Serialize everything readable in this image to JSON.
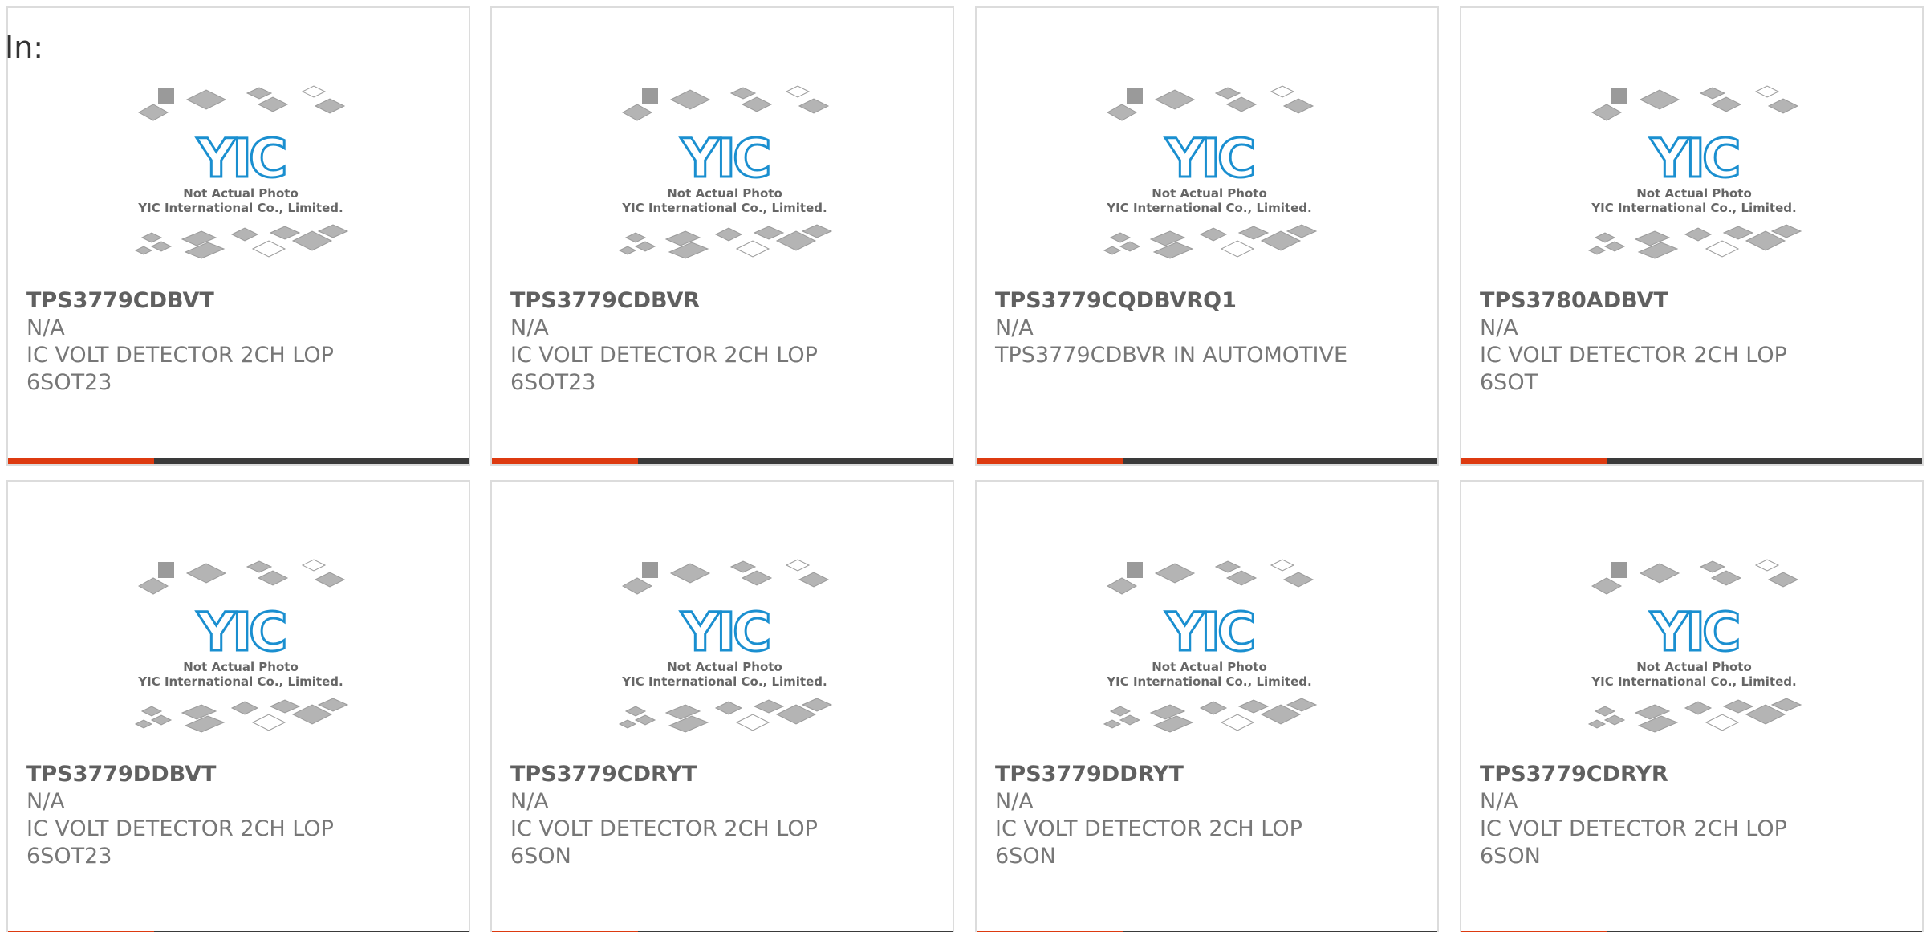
{
  "header": {
    "label": "In:"
  },
  "brand": {
    "accent": "#dd3a10",
    "bar": "#3a3a3a",
    "logo_blue": "#1a8fd0"
  },
  "placeholder": {
    "logo": "YIC",
    "line1": "Not Actual Photo",
    "line2": "YIC International Co., Limited."
  },
  "products": [
    {
      "part": "TPS3779CDBVT",
      "mfr": "N/A",
      "desc1": "IC VOLT DETECTOR 2CH LOP",
      "desc2": "6SOT23"
    },
    {
      "part": "TPS3779CDBVR",
      "mfr": "N/A",
      "desc1": "IC VOLT DETECTOR 2CH LOP",
      "desc2": "6SOT23"
    },
    {
      "part": "TPS3779CQDBVRQ1",
      "mfr": "N/A",
      "desc1": "TPS3779CDBVR IN AUTOMOTIVE",
      "desc2": ""
    },
    {
      "part": "TPS3780ADBVT",
      "mfr": "N/A",
      "desc1": "IC VOLT DETECTOR 2CH LOP",
      "desc2": "6SOT"
    },
    {
      "part": "TPS3779DDBVT",
      "mfr": "N/A",
      "desc1": "IC VOLT DETECTOR 2CH LOP",
      "desc2": "6SOT23"
    },
    {
      "part": "TPS3779CDRYT",
      "mfr": "N/A",
      "desc1": "IC VOLT DETECTOR 2CH LOP",
      "desc2": "6SON"
    },
    {
      "part": "TPS3779DDRYT",
      "mfr": "N/A",
      "desc1": "IC VOLT DETECTOR 2CH LOP",
      "desc2": "6SON"
    },
    {
      "part": "TPS3779CDRYR",
      "mfr": "N/A",
      "desc1": "IC VOLT DETECTOR 2CH LOP",
      "desc2": "6SON"
    }
  ]
}
